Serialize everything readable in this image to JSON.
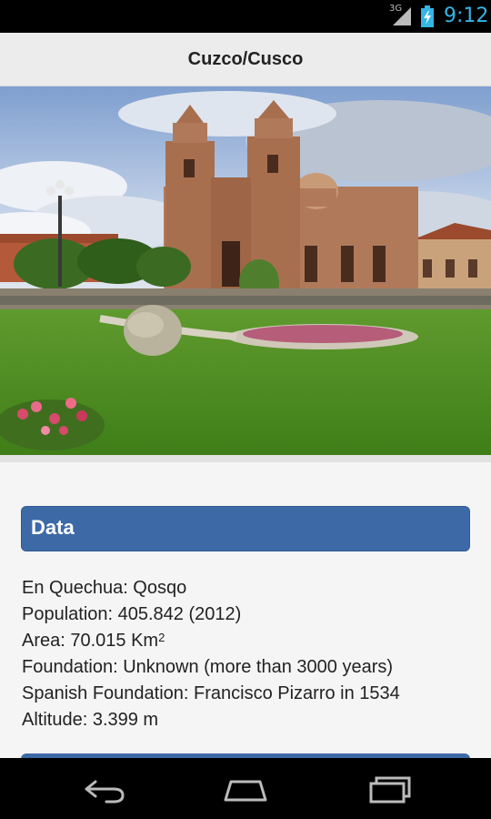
{
  "status_bar": {
    "network": "3G",
    "time": "9:12",
    "icons": [
      "signal-icon",
      "battery-charging-icon"
    ]
  },
  "action_bar": {
    "title": "Cuzco/Cusco"
  },
  "photo": {
    "icon": "city-photo"
  },
  "data_section": {
    "header": "Data",
    "en_quechua": "En Quechua: Qosqo",
    "population": "Population: 405.842 (2012)",
    "area_prefix": "Area: 70.015 Km",
    "area_sup": "2",
    "foundation": "Foundation: Unknown (more than 3000 years)",
    "spanish_foundation": "Spanish Foundation: Francisco Pizarro in 1534",
    "altitude": "Altitude: 3.399 m"
  },
  "nav_bar": {
    "icons": [
      "back-icon",
      "home-icon",
      "recent-apps-icon"
    ]
  },
  "colors": {
    "accent": "#33b5e5",
    "section_header": "#3d6aa6"
  }
}
